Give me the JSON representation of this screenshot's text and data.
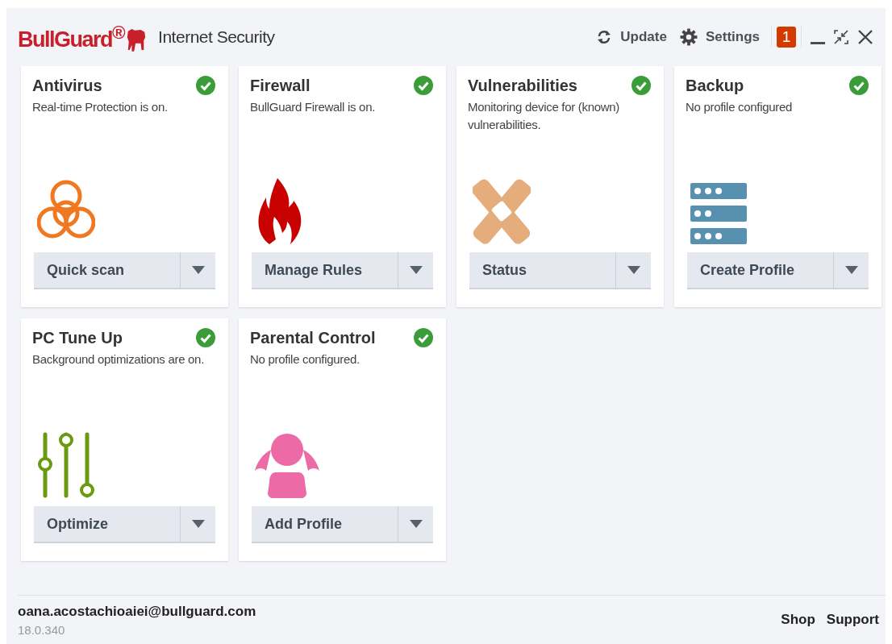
{
  "header": {
    "brand": "BullGuard$^{®}$",
    "product": "Internet Security",
    "actions": [
      {
        "kind": "update",
        "label": "Update"
      },
      {
        "kind": "settings",
        "label": "Settings"
      }
    ],
    "notifications": "1"
  },
  "cards": [
    {
      "title": "Antivirus",
      "description": "Real-time Protection is on.",
      "ok": true,
      "kind": "biohazard",
      "button": "Quick scan"
    },
    {
      "title": "Firewall",
      "description": "BullGuard Firewall is on.",
      "ok": true,
      "kind": "flame",
      "button": "Manage Rules"
    },
    {
      "title": "Vulnerabilities",
      "description": "Monitoring device for (known) vulnerabilities.",
      "ok": true,
      "kind": "bandage",
      "button": "Status"
    },
    {
      "title": "Backup",
      "description": "No profile configured",
      "ok": true,
      "kind": "server",
      "button": "Create Profile"
    },
    {
      "title": "PC Tune Up",
      "description": "Background optimizations are on.",
      "ok": true,
      "kind": "sliders",
      "button": "Optimize"
    },
    {
      "title": "Parental Control",
      "description": "No profile configured.",
      "ok": true,
      "kind": "child",
      "button": "Add Profile"
    }
  ],
  "footer": {
    "email": "oana.acostachioaiei@bullguard.com",
    "version": "18.0.340",
    "links": [
      "Shop",
      "Support"
    ]
  }
}
